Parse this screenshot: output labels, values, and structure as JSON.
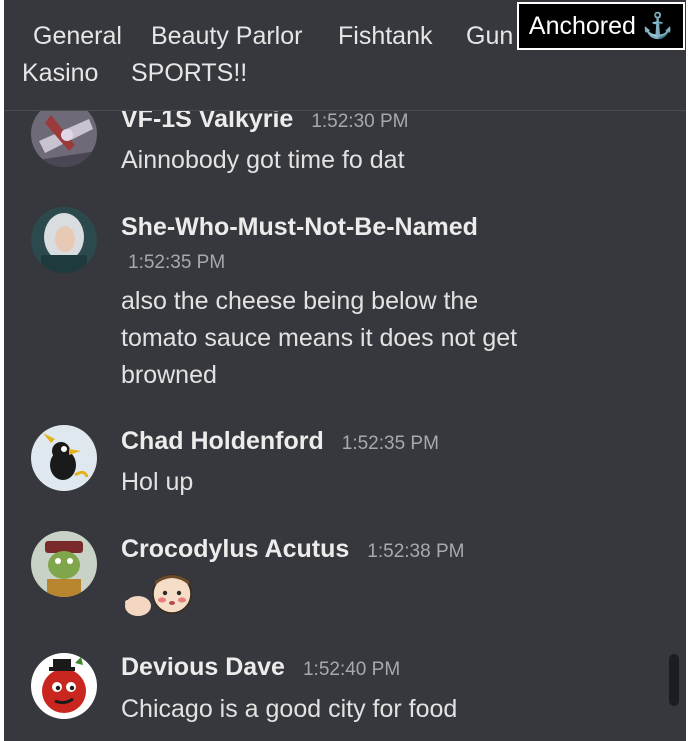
{
  "tabs": {
    "items": [
      "General",
      "Beauty Parlor",
      "Fishtank",
      "Gun",
      "Kasino",
      "SPORTS!!"
    ],
    "anchored_label": "Anchored",
    "anchored_icon": "anchor-icon"
  },
  "messages": [
    {
      "author": "VF-1S Valkyrie",
      "time": "1:52:30 PM",
      "text": "Ainnobody got time fo dat",
      "avatar": "mecha-avatar"
    },
    {
      "author": "She-Who-Must-Not-Be-Named",
      "time": "1:52:35 PM",
      "text": "also the cheese being below the tomato sauce means it does not get browned",
      "avatar": "woman-avatar"
    },
    {
      "author": "Chad Holdenford",
      "time": "1:52:35 PM",
      "text": "Hol up",
      "avatar": "cartoon-bird-avatar"
    },
    {
      "author": "Crocodylus Acutus",
      "time": "1:52:38 PM",
      "text": "",
      "emoji": [
        "pointing-hand-emoji",
        "blushing-face-emoji"
      ],
      "avatar": "crocodile-avatar"
    },
    {
      "author": "Devious Dave",
      "time": "1:52:40 PM",
      "text": "Chicago is a good city for food",
      "avatar": "tomato-avatar"
    }
  ],
  "colors": {
    "background": "#36383d",
    "author": "#ececec",
    "timestamp": "#a7a9ad",
    "text": "#e2e2e2"
  }
}
